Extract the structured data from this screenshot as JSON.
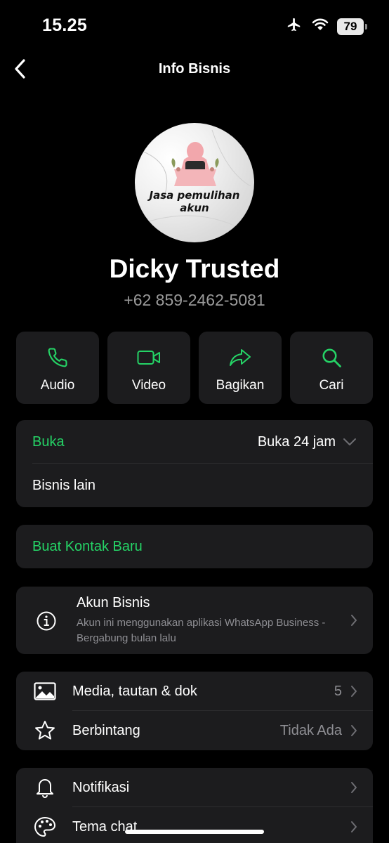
{
  "status": {
    "time": "15.25",
    "battery": "79"
  },
  "nav": {
    "title": "Info Bisnis"
  },
  "profile": {
    "avatar_caption": "Jasa pemulihan akun",
    "name": "Dicky Trusted",
    "phone": "+62 859-2462-5081"
  },
  "actions": [
    {
      "label": "Audio",
      "icon": "phone-icon"
    },
    {
      "label": "Video",
      "icon": "video-icon"
    },
    {
      "label": "Bagikan",
      "icon": "share-icon"
    },
    {
      "label": "Cari",
      "icon": "search-icon"
    }
  ],
  "hours": {
    "label": "Buka",
    "value": "Buka 24 jam",
    "other": "Bisnis lain"
  },
  "new_contact": {
    "label": "Buat Kontak Baru"
  },
  "business": {
    "title": "Akun Bisnis",
    "subtitle": "Akun ini menggunakan aplikasi WhatsApp Business - Bergabung bulan lalu"
  },
  "media": {
    "label": "Media, tautan & dok",
    "count": "5",
    "starred_label": "Berbintang",
    "starred_value": "Tidak Ada"
  },
  "settings": {
    "notifications": "Notifikasi",
    "theme": "Tema chat"
  },
  "colors": {
    "accent": "#25d366",
    "background": "#000000",
    "card": "#1c1c1e",
    "muted": "#8e8e93"
  }
}
